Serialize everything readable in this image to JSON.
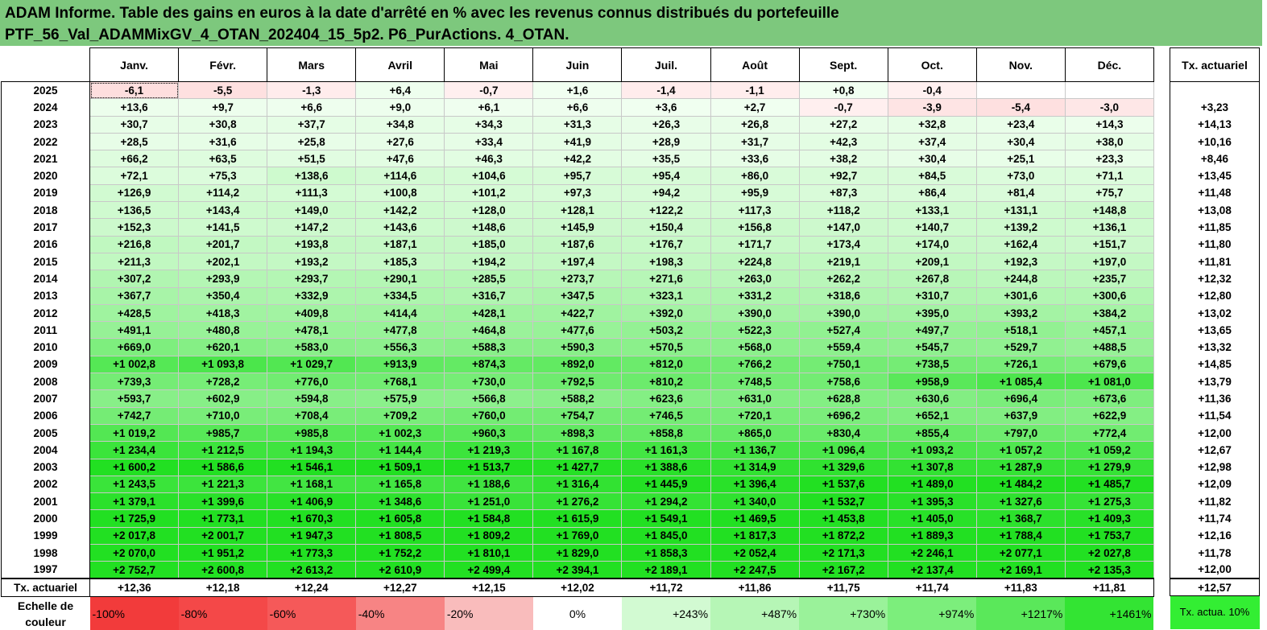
{
  "title": {
    "line1": "ADAM Informe. Table des gains en euros à la date d'arrêté en % avec les revenus connus distribués du portefeuille",
    "line2": "PTF_56_Val_ADAMMixGV_4_OTAN_202404_15_5p2. P6_PurActions. 4_OTAN."
  },
  "table": {
    "months": [
      "Janv.",
      "Févr.",
      "Mars",
      "Avril",
      "Mai",
      "Juin",
      "Juil.",
      "Août",
      "Sept.",
      "Oct.",
      "Nov.",
      "Déc."
    ],
    "tx_header": "Tx. actuariel",
    "rows": [
      {
        "year": "2025",
        "values": [
          "-6,1",
          "-5,5",
          "-1,3",
          "+6,4",
          "-0,7",
          "+1,6",
          "-1,4",
          "-1,1",
          "+0,8",
          "-0,4",
          "",
          ""
        ],
        "tx": ""
      },
      {
        "year": "2024",
        "values": [
          "+13,6",
          "+9,7",
          "+6,6",
          "+9,0",
          "+6,1",
          "+6,6",
          "+3,6",
          "+2,7",
          "-0,7",
          "-3,9",
          "-5,4",
          "-3,0"
        ],
        "tx": "+3,23"
      },
      {
        "year": "2023",
        "values": [
          "+30,7",
          "+30,8",
          "+37,7",
          "+34,8",
          "+34,3",
          "+31,3",
          "+26,3",
          "+26,8",
          "+27,2",
          "+32,8",
          "+23,4",
          "+14,3"
        ],
        "tx": "+14,13"
      },
      {
        "year": "2022",
        "values": [
          "+28,5",
          "+31,6",
          "+25,8",
          "+27,6",
          "+33,4",
          "+41,9",
          "+28,9",
          "+31,7",
          "+42,3",
          "+37,4",
          "+30,4",
          "+38,0"
        ],
        "tx": "+10,16"
      },
      {
        "year": "2021",
        "values": [
          "+66,2",
          "+63,5",
          "+51,5",
          "+47,6",
          "+46,3",
          "+42,2",
          "+35,5",
          "+33,6",
          "+38,2",
          "+30,4",
          "+25,1",
          "+23,3"
        ],
        "tx": "+8,46"
      },
      {
        "year": "2020",
        "values": [
          "+72,1",
          "+75,3",
          "+138,6",
          "+114,6",
          "+104,6",
          "+95,7",
          "+95,4",
          "+86,0",
          "+92,7",
          "+84,5",
          "+73,0",
          "+71,1"
        ],
        "tx": "+13,45"
      },
      {
        "year": "2019",
        "values": [
          "+126,9",
          "+114,2",
          "+111,3",
          "+100,8",
          "+101,2",
          "+97,3",
          "+94,2",
          "+95,9",
          "+87,3",
          "+86,4",
          "+81,4",
          "+75,7"
        ],
        "tx": "+11,48"
      },
      {
        "year": "2018",
        "values": [
          "+136,5",
          "+143,4",
          "+149,0",
          "+142,2",
          "+128,0",
          "+128,1",
          "+122,2",
          "+117,3",
          "+118,2",
          "+133,1",
          "+131,1",
          "+148,8"
        ],
        "tx": "+13,08"
      },
      {
        "year": "2017",
        "values": [
          "+152,3",
          "+141,5",
          "+147,2",
          "+143,6",
          "+148,6",
          "+145,9",
          "+150,4",
          "+156,8",
          "+147,0",
          "+140,7",
          "+139,2",
          "+136,1"
        ],
        "tx": "+11,85"
      },
      {
        "year": "2016",
        "values": [
          "+216,8",
          "+201,7",
          "+193,8",
          "+187,1",
          "+185,0",
          "+187,6",
          "+176,7",
          "+171,7",
          "+173,4",
          "+174,0",
          "+162,4",
          "+151,7"
        ],
        "tx": "+11,80"
      },
      {
        "year": "2015",
        "values": [
          "+211,3",
          "+202,1",
          "+193,2",
          "+185,3",
          "+194,2",
          "+197,4",
          "+198,3",
          "+224,8",
          "+219,1",
          "+209,1",
          "+192,3",
          "+197,0"
        ],
        "tx": "+11,81"
      },
      {
        "year": "2014",
        "values": [
          "+307,2",
          "+293,9",
          "+293,7",
          "+290,1",
          "+285,5",
          "+273,7",
          "+271,6",
          "+263,0",
          "+262,2",
          "+267,8",
          "+244,8",
          "+235,7"
        ],
        "tx": "+12,32"
      },
      {
        "year": "2013",
        "values": [
          "+367,7",
          "+350,4",
          "+332,9",
          "+334,5",
          "+316,7",
          "+347,5",
          "+323,1",
          "+331,2",
          "+318,6",
          "+310,7",
          "+301,6",
          "+300,6"
        ],
        "tx": "+12,80"
      },
      {
        "year": "2012",
        "values": [
          "+428,5",
          "+418,3",
          "+409,8",
          "+414,4",
          "+428,1",
          "+422,7",
          "+392,0",
          "+390,0",
          "+390,0",
          "+395,0",
          "+393,2",
          "+384,2"
        ],
        "tx": "+13,02"
      },
      {
        "year": "2011",
        "values": [
          "+491,1",
          "+480,8",
          "+478,1",
          "+477,8",
          "+464,8",
          "+477,6",
          "+503,2",
          "+522,3",
          "+527,4",
          "+497,7",
          "+518,1",
          "+457,1"
        ],
        "tx": "+13,65"
      },
      {
        "year": "2010",
        "values": [
          "+669,0",
          "+620,1",
          "+583,0",
          "+556,3",
          "+588,3",
          "+590,3",
          "+570,5",
          "+568,0",
          "+559,4",
          "+545,7",
          "+529,7",
          "+488,5"
        ],
        "tx": "+13,32"
      },
      {
        "year": "2009",
        "values": [
          "+1 002,8",
          "+1 093,8",
          "+1 029,7",
          "+913,9",
          "+874,3",
          "+892,0",
          "+812,0",
          "+766,2",
          "+750,1",
          "+738,5",
          "+726,1",
          "+679,6"
        ],
        "tx": "+14,85"
      },
      {
        "year": "2008",
        "values": [
          "+739,3",
          "+728,2",
          "+776,0",
          "+768,1",
          "+730,0",
          "+792,5",
          "+810,2",
          "+748,5",
          "+758,6",
          "+958,9",
          "+1 085,4",
          "+1 081,0"
        ],
        "tx": "+13,79"
      },
      {
        "year": "2007",
        "values": [
          "+593,7",
          "+602,9",
          "+594,8",
          "+575,9",
          "+566,8",
          "+588,2",
          "+623,6",
          "+631,0",
          "+628,8",
          "+630,6",
          "+696,4",
          "+673,6"
        ],
        "tx": "+11,36"
      },
      {
        "year": "2006",
        "values": [
          "+742,7",
          "+710,0",
          "+708,4",
          "+709,2",
          "+760,0",
          "+754,7",
          "+746,5",
          "+720,1",
          "+696,2",
          "+652,1",
          "+637,9",
          "+622,9"
        ],
        "tx": "+11,54"
      },
      {
        "year": "2005",
        "values": [
          "+1 019,2",
          "+985,7",
          "+985,8",
          "+1 002,3",
          "+960,3",
          "+898,3",
          "+858,8",
          "+865,0",
          "+830,4",
          "+855,4",
          "+797,0",
          "+772,4"
        ],
        "tx": "+12,00"
      },
      {
        "year": "2004",
        "values": [
          "+1 234,4",
          "+1 212,5",
          "+1 194,3",
          "+1 144,4",
          "+1 219,3",
          "+1 167,8",
          "+1 161,3",
          "+1 136,7",
          "+1 096,4",
          "+1 093,2",
          "+1 057,2",
          "+1 059,2"
        ],
        "tx": "+12,67"
      },
      {
        "year": "2003",
        "values": [
          "+1 600,2",
          "+1 586,6",
          "+1 546,1",
          "+1 509,1",
          "+1 513,7",
          "+1 427,7",
          "+1 388,6",
          "+1 314,9",
          "+1 329,6",
          "+1 307,8",
          "+1 287,9",
          "+1 279,9"
        ],
        "tx": "+12,98"
      },
      {
        "year": "2002",
        "values": [
          "+1 243,5",
          "+1 221,3",
          "+1 168,1",
          "+1 165,8",
          "+1 188,6",
          "+1 316,4",
          "+1 445,9",
          "+1 396,4",
          "+1 537,6",
          "+1 489,0",
          "+1 484,2",
          "+1 485,7"
        ],
        "tx": "+12,09"
      },
      {
        "year": "2001",
        "values": [
          "+1 379,1",
          "+1 399,6",
          "+1 406,9",
          "+1 348,6",
          "+1 251,0",
          "+1 276,2",
          "+1 294,2",
          "+1 340,0",
          "+1 532,7",
          "+1 395,3",
          "+1 327,6",
          "+1 275,3"
        ],
        "tx": "+11,82"
      },
      {
        "year": "2000",
        "values": [
          "+1 725,9",
          "+1 773,1",
          "+1 670,3",
          "+1 605,8",
          "+1 584,8",
          "+1 615,9",
          "+1 549,1",
          "+1 469,5",
          "+1 453,8",
          "+1 405,0",
          "+1 368,7",
          "+1 409,3"
        ],
        "tx": "+11,74"
      },
      {
        "year": "1999",
        "values": [
          "+2 017,8",
          "+2 001,7",
          "+1 947,3",
          "+1 808,5",
          "+1 809,2",
          "+1 769,0",
          "+1 845,0",
          "+1 817,3",
          "+1 872,2",
          "+1 889,3",
          "+1 788,4",
          "+1 753,7"
        ],
        "tx": "+12,16"
      },
      {
        "year": "1998",
        "values": [
          "+2 070,0",
          "+1 951,2",
          "+1 773,3",
          "+1 752,2",
          "+1 810,1",
          "+1 829,0",
          "+1 858,3",
          "+2 052,4",
          "+2 171,3",
          "+2 246,1",
          "+2 077,1",
          "+2 027,8"
        ],
        "tx": "+11,78"
      },
      {
        "year": "1997",
        "values": [
          "+2 752,7",
          "+2 600,8",
          "+2 613,2",
          "+2 610,9",
          "+2 499,4",
          "+2 394,1",
          "+2 189,1",
          "+2 247,5",
          "+2 167,2",
          "+2 137,4",
          "+2 169,1",
          "+2 135,3"
        ],
        "tx": "+12,00"
      }
    ],
    "tx_row": {
      "label": "Tx. actuariel",
      "values": [
        "+12,36",
        "+12,18",
        "+12,24",
        "+12,27",
        "+12,15",
        "+12,02",
        "+11,72",
        "+11,86",
        "+11,75",
        "+11,74",
        "+11,83",
        "+11,81"
      ],
      "total": "+12,57"
    },
    "scale": {
      "label": "Echelle de couleur",
      "steps": [
        {
          "label": "-100%",
          "color": "#f23b3b"
        },
        {
          "label": "-80%",
          "color": "#f44848"
        },
        {
          "label": "-60%",
          "color": "#f55959"
        },
        {
          "label": "-40%",
          "color": "#f78484"
        },
        {
          "label": "-20%",
          "color": "#f9bcbc"
        },
        {
          "label": "0%",
          "color": "#ffffff"
        },
        {
          "label": "+243%",
          "color": "#d2fad2"
        },
        {
          "label": "+487%",
          "color": "#b6f6b6"
        },
        {
          "label": "+730%",
          "color": "#9af29a"
        },
        {
          "label": "+974%",
          "color": "#7cee7c"
        },
        {
          "label": "+1217%",
          "color": "#5ae85a"
        },
        {
          "label": "+1461%",
          "color": "#33e433"
        }
      ],
      "tx_label": "Tx. actua. 10%"
    }
  }
}
